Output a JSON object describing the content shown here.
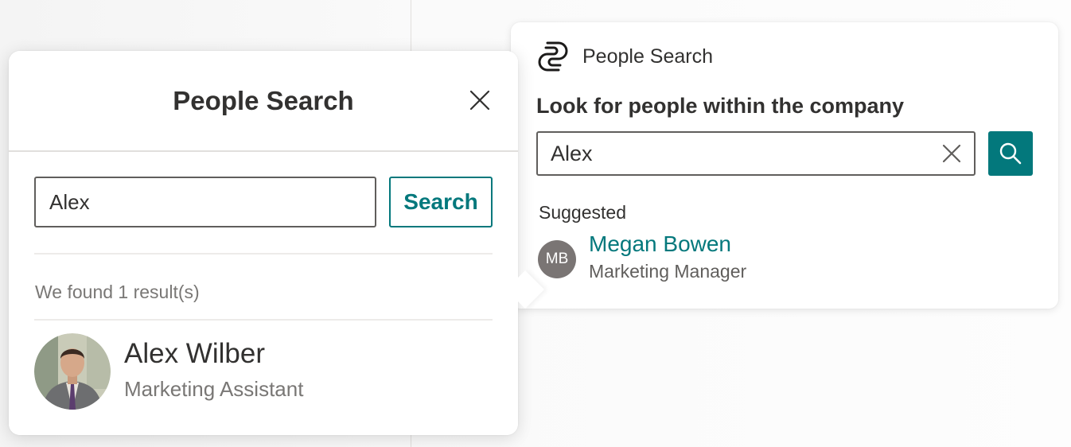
{
  "card": {
    "app_name": "People Search",
    "heading": "Look for people within the company",
    "search_value": "Alex",
    "suggested_label": "Suggested",
    "suggestion": {
      "initials": "MB",
      "name": "Megan Bowen",
      "title": "Marketing Manager"
    },
    "icons": {
      "app": "people-search-logo-icon",
      "clear": "close-icon",
      "search": "search-icon"
    }
  },
  "panel": {
    "title": "People Search",
    "search_value": "Alex",
    "search_button_label": "Search",
    "result_count_text": "We found 1 result(s)",
    "result": {
      "name": "Alex Wilber",
      "title": "Marketing Assistant"
    },
    "icons": {
      "close": "close-icon"
    }
  },
  "colors": {
    "accent": "#03787c",
    "text_primary": "#323130",
    "text_secondary": "#797775",
    "avatar_bg": "#7a7574"
  }
}
